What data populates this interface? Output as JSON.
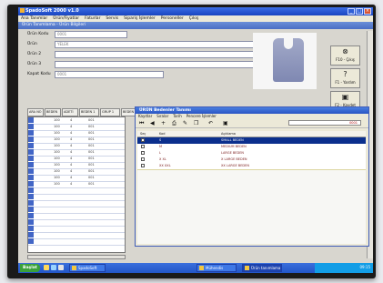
{
  "window": {
    "title": "SpadoSoft 2000 v1.0"
  },
  "menu": [
    "Ana Tanımlar",
    "Ürün/Fiyatlar",
    "Faturlar",
    "Servis",
    "Sipariş İşlemler",
    "Personeller",
    "Çıkış"
  ],
  "inner": {
    "title": "Ürün Tanımlama - Ürün Bilgileri"
  },
  "form": {
    "fields": [
      {
        "label": "Ürün Kodu",
        "value": "0001"
      },
      {
        "label": "Ürün",
        "value": "YELEK"
      },
      {
        "label": "Ürün 2",
        "value": ""
      },
      {
        "label": "Ürün 3",
        "value": ""
      },
      {
        "label": "Kapat Kodu",
        "value": "0001"
      }
    ]
  },
  "side_buttons": [
    {
      "label": "F10 - Çıkış",
      "icon": "close-icon"
    },
    {
      "label": "F1 - Yardım",
      "icon": "help-icon"
    },
    {
      "label": "F2 - Kaydet",
      "icon": "save-icon"
    }
  ],
  "grid": {
    "headers": [
      "ARA NO",
      "BEDEN",
      "ADETİ",
      "BEDEN 1",
      "GRUP 1",
      "BEDEN 2",
      "GRUP 2",
      "BEDEN ROZETTE",
      "BEDEN MEKTUP",
      "BEDEN ROZETTE"
    ],
    "rows": [
      [
        "1",
        "100",
        "4",
        "001"
      ],
      [
        "2",
        "100",
        "4",
        "001"
      ],
      [
        "3",
        "100",
        "4",
        "001"
      ],
      [
        "4",
        "100",
        "4",
        "001"
      ],
      [
        "5",
        "100",
        "4",
        "001"
      ],
      [
        "6",
        "100",
        "4",
        "001"
      ],
      [
        "7",
        "100",
        "4",
        "001"
      ],
      [
        "8",
        "100",
        "4",
        "001"
      ],
      [
        "9",
        "100",
        "4",
        "001"
      ],
      [
        "10",
        "100",
        "4",
        "001"
      ],
      [
        "11",
        "100",
        "4",
        "001"
      ],
      [
        "12",
        "",
        "",
        ""
      ],
      [
        "13",
        "",
        "",
        ""
      ],
      [
        "14",
        "",
        "",
        ""
      ],
      [
        "15",
        "",
        "",
        ""
      ],
      [
        "16",
        "",
        "",
        ""
      ],
      [
        "17",
        "",
        "",
        ""
      ],
      [
        "18",
        "",
        "",
        ""
      ],
      [
        "19",
        "",
        "",
        ""
      ],
      [
        "20",
        "",
        "",
        ""
      ]
    ]
  },
  "sub_window": {
    "title": "ÜRÜN Bedenler Tanımı",
    "menu": [
      "Kayıtlar",
      "Sıralar",
      "Tarih",
      "Pencere İşlemler"
    ],
    "search_value": "0001",
    "headers": [
      "Seç",
      "Kod",
      "Açıklama"
    ],
    "rows": [
      {
        "code": "S",
        "desc": "SMALL BEDEN",
        "selected": true
      },
      {
        "code": "M",
        "desc": "MEDIUM BEDEN",
        "selected": false
      },
      {
        "code": "L",
        "desc": "LARGE BEDEN",
        "selected": false
      },
      {
        "code": "X XL",
        "desc": "X LARGE BEDEN",
        "selected": false
      },
      {
        "code": "XX XXL",
        "desc": "XX LARGE BEDEN",
        "selected": false
      }
    ]
  },
  "taskbar": {
    "start": "Başlat",
    "tasks": [
      "SpadoSoft",
      "Mühendis",
      "Ürün tanımlama"
    ],
    "time": "09:15"
  }
}
